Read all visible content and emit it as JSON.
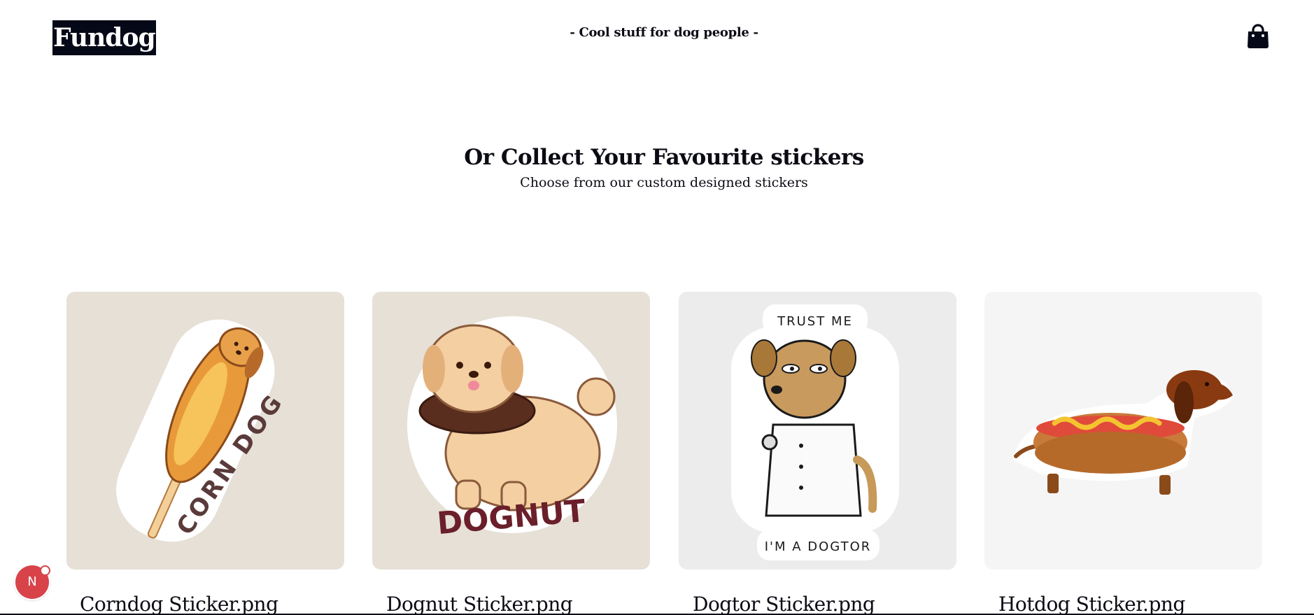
{
  "header": {
    "logo_text": "Fundog",
    "tagline": "- Cool stuff for dog people -",
    "cart_icon": "shopping-bag-icon"
  },
  "section": {
    "title": "Or Collect Your Favourite stickers",
    "subtitle": "Choose from our custom designed stickers"
  },
  "products": [
    {
      "name": "Corndog Sticker.png",
      "bg": "#e6e0d6",
      "image_text": "CORN DOG"
    },
    {
      "name": "Dognut Sticker.png",
      "bg": "#e6e0d6",
      "image_text": "DOGNUT"
    },
    {
      "name": "Dogtor Sticker.png",
      "bg": "#ececec",
      "image_text_top": "TRUST ME",
      "image_text_bottom": "I'M A DOGTOR"
    },
    {
      "name": "Hotdog Sticker.png",
      "bg": "#f5f5f5"
    }
  ],
  "dev_badge": {
    "label": "N",
    "color": "#d8434a"
  },
  "colors": {
    "text": "#0b0b14",
    "logo_bg": "#050816"
  }
}
